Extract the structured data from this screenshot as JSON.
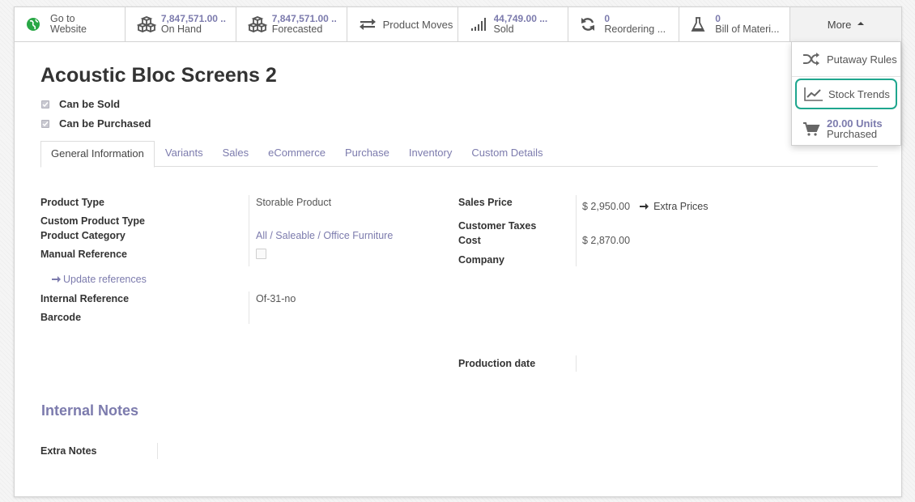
{
  "button_bar": {
    "website": {
      "line1": "Go to",
      "line2": "Website"
    },
    "on_hand": {
      "value": "7,847,571.00 ..",
      "label": "On Hand"
    },
    "forecasted": {
      "value": "7,847,571.00 ..",
      "label": "Forecasted"
    },
    "product_moves": {
      "label": "Product Moves"
    },
    "sold": {
      "value": "44,749.00 ...",
      "label": "Sold"
    },
    "reordering": {
      "value": "0",
      "label": "Reordering ..."
    },
    "bom": {
      "value": "0",
      "label": "Bill of Materi..."
    },
    "more": {
      "label": "More"
    }
  },
  "more_menu": {
    "putaway": "Putaway Rules",
    "stock_trends": "Stock Trends",
    "purchased_value": "20.00 Units",
    "purchased_label": "Purchased"
  },
  "product": {
    "name": "Acoustic Bloc Screens 2",
    "can_be_sold": "Can be Sold",
    "can_be_purchased": "Can be Purchased"
  },
  "tabs": [
    "General Information",
    "Variants",
    "Sales",
    "eCommerce",
    "Purchase",
    "Inventory",
    "Custom Details"
  ],
  "fields": {
    "product_type_label": "Product Type",
    "product_type_value": "Storable Product",
    "custom_type_label": "Custom Product Type",
    "category_label": "Product Category",
    "category_value": "All / Saleable / Office Furniture",
    "manual_ref_label": "Manual Reference",
    "update_refs": "Update references",
    "internal_ref_label": "Internal Reference",
    "internal_ref_value": "Of-31-no",
    "barcode_label": "Barcode",
    "sales_price_label": "Sales Price",
    "sales_price_value": "$ 2,950.00",
    "extra_prices": "Extra Prices",
    "customer_taxes_label": "Customer Taxes",
    "cost_label": "Cost",
    "cost_value": "$ 2,870.00",
    "company_label": "Company",
    "production_date_label": "Production date"
  },
  "notes": {
    "section_title": "Internal Notes",
    "extra_notes_label": "Extra Notes"
  },
  "colors": {
    "accent": "#7c7bad",
    "highlight": "#1fa68e",
    "globe": "#28a745"
  }
}
